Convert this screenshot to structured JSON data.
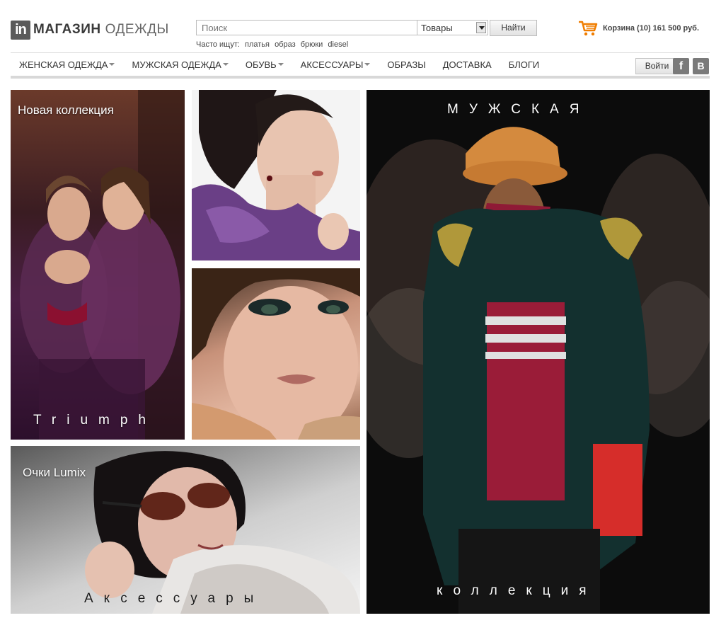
{
  "header": {
    "logo_badge": "in",
    "logo_word1": "МАГАЗИН",
    "logo_word2": "ОДЕЖДЫ",
    "search_placeholder": "Поиск",
    "search_category": "Товары",
    "search_button": "Найти",
    "popular_label": "Часто ищут:",
    "popular_terms": [
      "платья",
      "образ",
      "брюки",
      "diesel"
    ],
    "cart_text": "Корзина (10) 161 500 руб."
  },
  "nav": {
    "items": [
      {
        "label": "ЖЕНСКАЯ ОДЕЖДА",
        "dropdown": true
      },
      {
        "label": "МУЖСКАЯ ОДЕЖДА",
        "dropdown": true
      },
      {
        "label": "ОБУВЬ",
        "dropdown": true
      },
      {
        "label": "АКСЕССУАРЫ",
        "dropdown": true
      },
      {
        "label": "ОБРАЗЫ",
        "dropdown": false
      },
      {
        "label": "ДОСТАВКА",
        "dropdown": false
      },
      {
        "label": "БЛОГИ",
        "dropdown": false
      }
    ],
    "login_button": "Войти",
    "social": {
      "facebook": "f",
      "vkontakte": "B"
    }
  },
  "tiles": {
    "new_collection": {
      "title": "Новая коллекция",
      "caption": "Triumph"
    },
    "glasses": {
      "title": "Очки Lumix",
      "caption": "Аксессуары"
    },
    "mens": {
      "title": "МУЖСКАЯ",
      "caption": "коллекция"
    }
  },
  "colors": {
    "cart_icon": "#f07d00",
    "accent_text": "#333333"
  }
}
